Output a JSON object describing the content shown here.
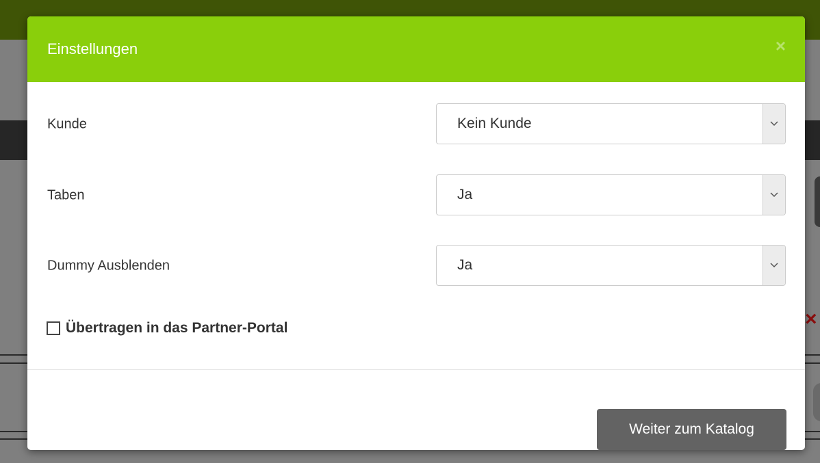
{
  "modal": {
    "title": "Einstellungen",
    "close_glyph": "×",
    "fields": [
      {
        "label": "Kunde",
        "value": "Kein Kunde"
      },
      {
        "label": "Taben",
        "value": "Ja"
      },
      {
        "label": "Dummy Ausblenden",
        "value": "Ja"
      }
    ],
    "checkbox_label": "Übertragen in das Partner-Portal",
    "checkbox_checked": false,
    "submit_label": "Weiter zum Katalog"
  },
  "background": {
    "delete_glyph": "×"
  },
  "colors": {
    "header_green": "#8acf0b",
    "button_gray": "#636363"
  }
}
